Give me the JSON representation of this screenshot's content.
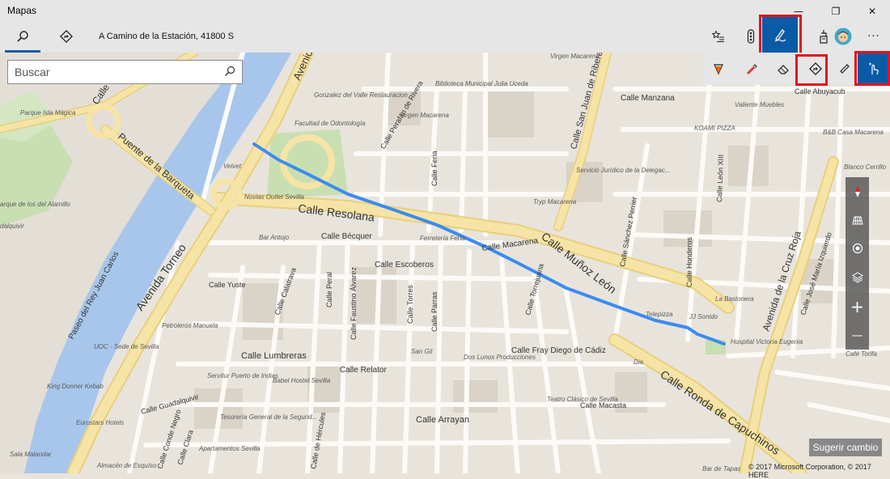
{
  "window": {
    "title": "Mapas",
    "minimize": "—",
    "maximize": "❐",
    "close": "✕"
  },
  "toolbar": {
    "address": "A Camino de la Estación, 41800 S",
    "icons": [
      "search-icon",
      "directions-icon",
      "favorites-icon",
      "traffic-icon",
      "ink-pen-icon",
      "3d-cities-icon",
      "profile-avatar",
      "more-icon"
    ],
    "more_label": "···"
  },
  "search": {
    "placeholder": "Buscar"
  },
  "ink_toolbar": {
    "tools": [
      "ballpoint-pen-icon",
      "highlighter-icon",
      "eraser-icon",
      "directions-ink-icon",
      "ruler-icon",
      "touch-writing-icon"
    ]
  },
  "map_controls": {
    "tools": [
      "compass-icon",
      "streetside-icon",
      "location-icon",
      "layers-icon",
      "zoom-in-icon",
      "zoom-out-icon"
    ],
    "zoom_in": "+",
    "zoom_out": "—"
  },
  "map": {
    "streets": {
      "resolana": "Calle Resolana",
      "munoz_leon": "Calle Muñoz León",
      "torneo": "Avenida Torneo",
      "ronda": "Calle Ronda de Capuchinos",
      "barqueta": "Puente de la Barqueta",
      "paseo": "Paseo del Rey Juan Carlos",
      "becquer": "Calle Bécquer",
      "escoberos": "Calle Escoberos",
      "macarena": "Calle Macarena",
      "manzana": "Calle Manzana",
      "abuyacub": "Calle Abuyacub",
      "yuste": "Calle Yuste",
      "lumbreras": "Calle Lumbreras",
      "relator": "Calle Relator",
      "guadalquivir": "Calle Guadalquivir",
      "arrayan": "Calle Arrayan",
      "fray_diego": "Calle Fray Diego de Cádiz",
      "macasta": "Calle Macasta",
      "cruz_roja": "Avenida de la Cruz Roja",
      "san_juan": "Calle San Juan de Ribera",
      "leon_xiii": "Calle León XIII",
      "honderos": "Calle Honderos",
      "sanchez_perrier": "Calle Sánchez Perrier",
      "feria": "Calle Feria",
      "peral": "Calle Peral",
      "torres": "Calle Torres",
      "parras": "Calle Parras",
      "faustino": "Calle Faustino Álvarez",
      "calatrava": "Calle Calatrava",
      "perafan": "Calle Perafán de Rivera",
      "jose_maria": "Calle José María Izquierdo",
      "torrejuana": "Calle Torrejuana",
      "avenida_top": "Avenida",
      "calle_top": "Calle",
      "conde_negro": "Calle Conde Negro",
      "clara": "Calle Clara",
      "hercules": "Calle de Hércules"
    },
    "pois": {
      "gonzalez": "Gonzalez del Valle Restauracion",
      "odontologia": "Facultad de Odontología",
      "biblioteca": "Biblioteca Municipal Julia Uceda",
      "virgen": "Virgen Macarena",
      "virgen_top": "Virgen Macarena",
      "valiente": "Valiente Muebles",
      "koami": "KOAMI PIZZA",
      "bb": "B&B Casa Macarena",
      "blanco": "Blanco Cerrillo",
      "servicio": "Servicio Jurídico de la Delegac...",
      "tryp": "Tryp Macarena",
      "novias": "Novias Outlet Sevilla",
      "velvet": "Velvet",
      "bar_antojo": "Bar Antojo",
      "ferreteria": "Ferretería Feria",
      "bastonera": "La Bastonera",
      "telepizza": "Telepizza",
      "jj": "JJ Sonido",
      "hospital": "Hospital Victoria Eugenia",
      "cafe": "Café Torifa",
      "parque": "Parque Isla Mágica",
      "petroleros": "Petroleros Manuela",
      "uoc": "UOC - Sede de Sevilla",
      "king": "King Donner Kebab",
      "servitur": "Servitur Puerto de Indias",
      "babel": "Babel Hostel Sevilla",
      "san_gil": "San Gil",
      "dos_lunos": "Dos Lunos Producciones",
      "teatro": "Teatro Clásico de Sevilla",
      "eurostars": "Eurostars Hotels",
      "tesoreria": "Tesorería General de la Segurid...",
      "apartamentos": "Apartamentos Sevilla",
      "salamandra": "Sala Malandar",
      "almacen": "Almacén de Esquíso",
      "dia": "Dia",
      "bar_tapas": "Bar de Tapas",
      "parque_left": "arque de los del Alamillo",
      "guadalquivir_left": "dalquivir"
    }
  },
  "suggest_label": "Sugerir cambio",
  "copyright": "© 2017 Microsoft Corporation, © 2017 HERE",
  "colors": {
    "accent": "#0b5aa8",
    "highlight": "#e0141e",
    "route": "#3d8bf0",
    "water": "#a8c6ec",
    "park": "#c6dfb0",
    "major_road": "#f6e4a6"
  }
}
